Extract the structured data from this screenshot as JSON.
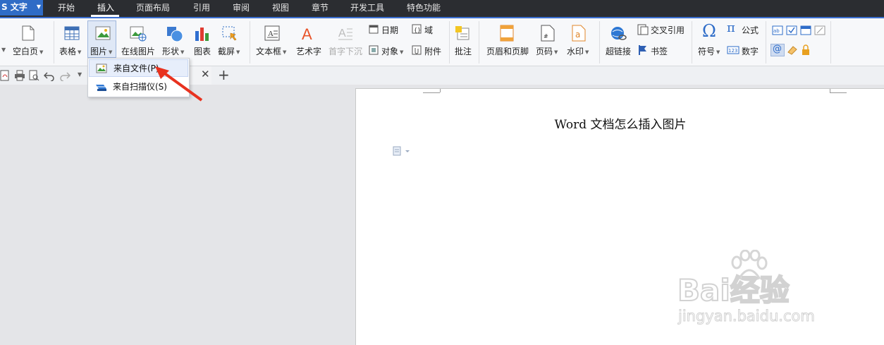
{
  "app": {
    "name": "S 文字"
  },
  "menu_tabs": [
    "开始",
    "插入",
    "页面布局",
    "引用",
    "审阅",
    "视图",
    "章节",
    "开发工具",
    "特色功能"
  ],
  "ribbon": {
    "blank_page": "空白页",
    "table": "表格",
    "picture": "图片",
    "online_picture": "在线图片",
    "shape": "形状",
    "chart": "图表",
    "screenshot": "截屏",
    "textbox": "文本框",
    "wordart": "艺术字",
    "dropcap": "首字下沉",
    "date": "日期",
    "object": "对象",
    "field": "域",
    "attachment": "附件",
    "comment": "批注",
    "header_footer": "页眉和页脚",
    "page_number": "页码",
    "watermark": "水印",
    "hyperlink": "超链接",
    "cross_reference": "交叉引用",
    "bookmark": "书签",
    "symbol": "符号",
    "formula": "公式",
    "number": "数字"
  },
  "picture_menu": {
    "from_file": "来自文件(P)",
    "from_scanner": "来自扫描仪(S)"
  },
  "document": {
    "title": "Word 文档怎么插入图片"
  },
  "watermark": {
    "brand": "Bai经验",
    "url": "jingyan.baidu.com"
  },
  "colors": {
    "accent": "#3b6fd1",
    "menubar": "#2b2d31",
    "arrow": "#e8321f"
  }
}
